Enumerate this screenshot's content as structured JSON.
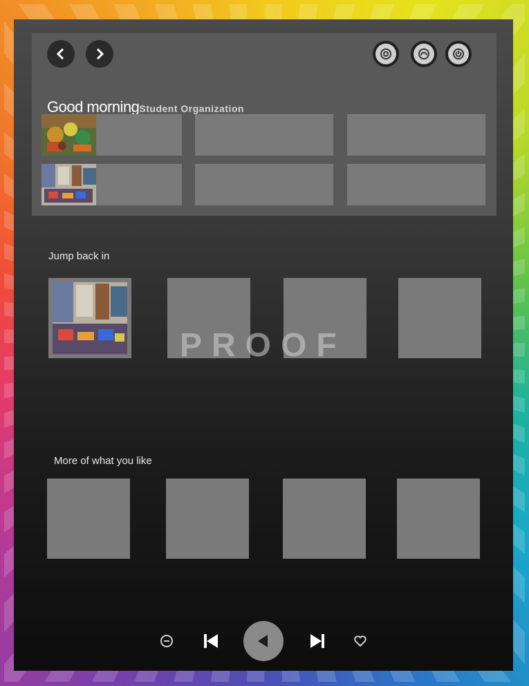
{
  "header": {
    "greeting": "Good morning",
    "organization": "Student Organization"
  },
  "sections": {
    "jump_back_in": {
      "title": "Jump back in"
    },
    "more_you_like": {
      "title": "More of what you like"
    }
  },
  "watermark": "PROOF",
  "icons": {
    "back": "chevron-left-icon",
    "forward": "chevron-right-icon",
    "account": "target-icon",
    "headphones": "headphones-icon",
    "power": "power-icon",
    "shuffle": "minus-circle-icon",
    "previous": "skip-previous-icon",
    "play": "play-icon",
    "next": "skip-next-icon",
    "like": "heart-icon"
  },
  "colors": {
    "panel": "#595959",
    "tile": "#7a7a7a"
  }
}
